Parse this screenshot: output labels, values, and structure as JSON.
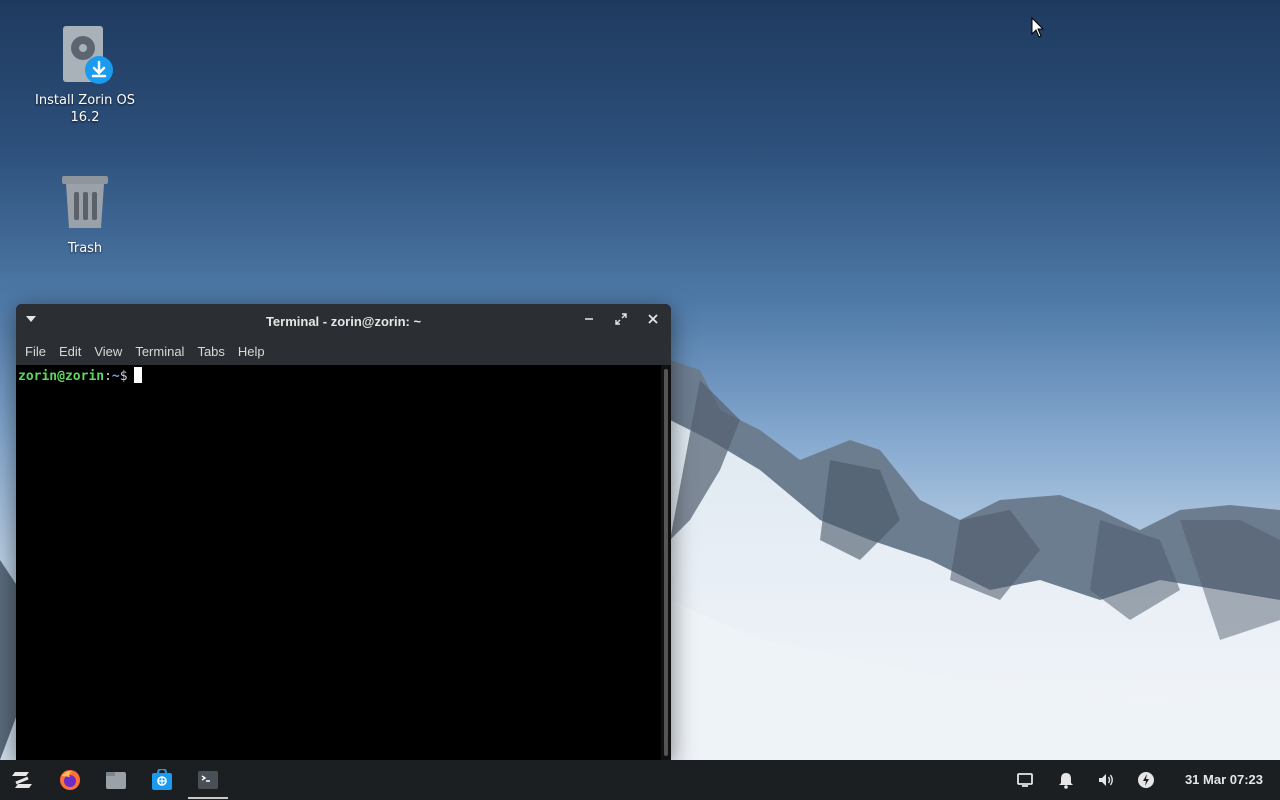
{
  "desktop": {
    "icons": [
      {
        "label": "Install Zorin OS 16.2",
        "label_line1": "Install Zorin OS",
        "label_line2": "16.2",
        "icon": "installer-icon"
      },
      {
        "label": "Trash",
        "icon": "trash-icon"
      }
    ]
  },
  "terminal": {
    "title": "Terminal - zorin@zorin: ~",
    "menu": [
      "File",
      "Edit",
      "View",
      "Terminal",
      "Tabs",
      "Help"
    ],
    "prompt_user": "zorin@zorin",
    "prompt_sep": ":",
    "prompt_path": "~",
    "prompt_symbol": "$"
  },
  "taskbar": {
    "launchers": [
      {
        "name": "zorin-menu-icon"
      },
      {
        "name": "firefox-icon"
      },
      {
        "name": "files-icon"
      },
      {
        "name": "software-store-icon"
      },
      {
        "name": "terminal-icon",
        "active": true
      }
    ],
    "tray": [
      "screen-icon",
      "bell-icon",
      "volume-icon",
      "power-icon"
    ],
    "clock": "31 Mar 07:23"
  },
  "colors": {
    "taskbar_bg": "#1c1f22",
    "titlebar_bg": "#2b2f33",
    "prompt_green": "#5fd75f",
    "prompt_blue": "#6e9fe6"
  }
}
